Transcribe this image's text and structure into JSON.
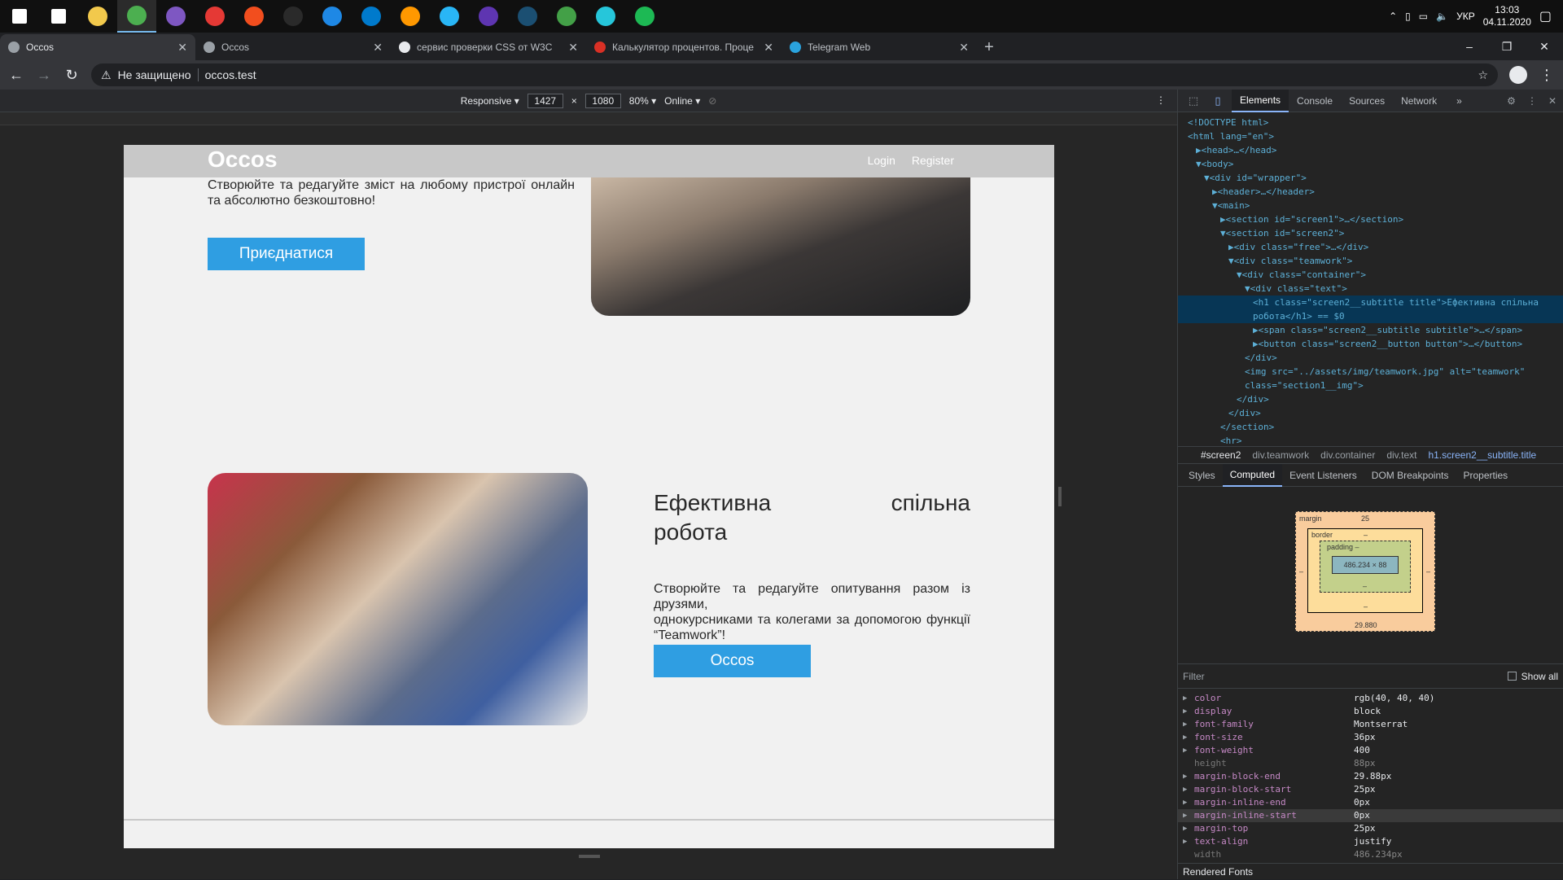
{
  "taskbar": {
    "icons": [
      {
        "name": "windows-start-icon",
        "color": "#ffffff"
      },
      {
        "name": "search-icon",
        "color": "#ffffff"
      },
      {
        "name": "file-explorer-icon",
        "color": "#f2c94c"
      },
      {
        "name": "chrome-icon",
        "color": "#4caf50"
      },
      {
        "name": "app-purple-icon",
        "color": "#7e57c2"
      },
      {
        "name": "app-rainbow-icon",
        "color": "#e53935"
      },
      {
        "name": "figma-icon",
        "color": "#f24e1e"
      },
      {
        "name": "epic-games-icon",
        "color": "#2a2a2a"
      },
      {
        "name": "app-blue-circle-icon",
        "color": "#1e88e5"
      },
      {
        "name": "vscode-icon",
        "color": "#007acc"
      },
      {
        "name": "sublime-text-icon",
        "color": "#ff9800"
      },
      {
        "name": "app-hexagon-icon",
        "color": "#29b6f6"
      },
      {
        "name": "app-dark-purple-icon",
        "color": "#5e35b1"
      },
      {
        "name": "steam-icon",
        "color": "#1b4f72"
      },
      {
        "name": "shield-icon",
        "color": "#43a047"
      },
      {
        "name": "app-teal-icon",
        "color": "#26c6da"
      },
      {
        "name": "spotify-icon",
        "color": "#1db954"
      }
    ],
    "language": "УКР",
    "time": "13:03",
    "date": "04.11.2020"
  },
  "tabs": [
    {
      "title": "Occos",
      "active": true,
      "color": "#9aa0a6"
    },
    {
      "title": "Occos",
      "active": false,
      "color": "#9aa0a6"
    },
    {
      "title": "сервис проверки CSS от W3C",
      "active": false,
      "color": "#e8eaed"
    },
    {
      "title": "Калькулятор процентов. Проце",
      "active": false,
      "color": "#d93025"
    },
    {
      "title": "Telegram Web",
      "active": false,
      "color": "#2aa3de"
    }
  ],
  "address": {
    "security": "Не защищено",
    "url": "occos.test"
  },
  "device_toolbar": {
    "mode": "Responsive",
    "width": "1427",
    "height": "1080",
    "zoom": "80%",
    "throttle": "Online"
  },
  "site": {
    "logo": "Occos",
    "nav_login": "Login",
    "nav_register": "Register",
    "screen1_text": "Створюйте та редагуйте зміст на любому пристрої онлайн та абсолютно безкоштовно!",
    "screen1_button": "Приєднатися",
    "screen2_title_line1": "Ефективна спільна",
    "screen2_title_line2": "робота",
    "screen2_text_line1": "Створюйте та редагуйте опитування разом із друзями,",
    "screen2_text_line2": "однокурсниками та колегами за допомогою функції “Teamwork”!",
    "screen2_button": "Occos"
  },
  "devtools": {
    "tabs": [
      "Elements",
      "Console",
      "Sources",
      "Network"
    ],
    "active_tab": "Elements",
    "more": "»",
    "dom_lines": [
      {
        "indent": 0,
        "text": "<!DOCTYPE html>",
        "sel": false
      },
      {
        "indent": 0,
        "text": "<html lang=\"en\">",
        "sel": false
      },
      {
        "indent": 1,
        "text": "▶<head>…</head>",
        "sel": false
      },
      {
        "indent": 1,
        "text": "▼<body>",
        "sel": false
      },
      {
        "indent": 2,
        "text": "▼<div id=\"wrapper\">",
        "sel": false
      },
      {
        "indent": 3,
        "text": "▶<header>…</header>",
        "sel": false
      },
      {
        "indent": 3,
        "text": "▼<main>",
        "sel": false
      },
      {
        "indent": 4,
        "text": "▶<section id=\"screen1\">…</section>",
        "sel": false
      },
      {
        "indent": 4,
        "text": "▼<section id=\"screen2\">",
        "sel": false
      },
      {
        "indent": 5,
        "text": "▶<div class=\"free\">…</div>",
        "sel": false
      },
      {
        "indent": 5,
        "text": "▼<div class=\"teamwork\">",
        "sel": false
      },
      {
        "indent": 6,
        "text": "▼<div class=\"container\">",
        "sel": false
      },
      {
        "indent": 7,
        "text": "▼<div class=\"text\">",
        "sel": false
      },
      {
        "indent": 8,
        "text": "<h1 class=\"screen2__subtitle title\">Ефективна спільна",
        "sel": true
      },
      {
        "indent": 8,
        "text": "робота</h1> == $0",
        "sel": true
      },
      {
        "indent": 8,
        "text": "▶<span class=\"screen2__subtitle subtitle\">…</span>",
        "sel": false
      },
      {
        "indent": 8,
        "text": "▶<button class=\"screen2__button button\">…</button>",
        "sel": false
      },
      {
        "indent": 7,
        "text": "</div>",
        "sel": false
      },
      {
        "indent": 7,
        "text": "<img src=\"../assets/img/teamwork.jpg\" alt=\"teamwork\"",
        "sel": false
      },
      {
        "indent": 7,
        "text": "class=\"section1__img\">",
        "sel": false
      },
      {
        "indent": 6,
        "text": "</div>",
        "sel": false
      },
      {
        "indent": 5,
        "text": "</div>",
        "sel": false
      },
      {
        "indent": 4,
        "text": "</section>",
        "sel": false
      },
      {
        "indent": 4,
        "text": "<hr>",
        "sel": false
      }
    ],
    "breadcrumbs": [
      "#screen2",
      "div.teamwork",
      "div.container",
      "div.text",
      "h1.screen2__subtitle.title"
    ],
    "sub_tabs": [
      "Styles",
      "Computed",
      "Event Listeners",
      "DOM Breakpoints",
      "Properties"
    ],
    "active_sub_tab": "Computed",
    "box_model": {
      "margin_label": "margin",
      "margin_top": "25",
      "margin_bottom": "29.880",
      "border_label": "border",
      "border_val": "–",
      "padding_label": "padding –",
      "padding_bottom": "–",
      "content": "486.234 × 88",
      "side": "–"
    },
    "filter_placeholder": "Filter",
    "show_all": "Show all",
    "computed": [
      {
        "name": "color",
        "value": "rgb(40, 40, 40)",
        "dim": false
      },
      {
        "name": "display",
        "value": "block",
        "dim": false
      },
      {
        "name": "font-family",
        "value": "Montserrat",
        "dim": false
      },
      {
        "name": "font-size",
        "value": "36px",
        "dim": false
      },
      {
        "name": "font-weight",
        "value": "400",
        "dim": false
      },
      {
        "name": "height",
        "value": "88px",
        "dim": true
      },
      {
        "name": "margin-block-end",
        "value": "29.88px",
        "dim": false
      },
      {
        "name": "margin-block-start",
        "value": "25px",
        "dim": false
      },
      {
        "name": "margin-inline-end",
        "value": "0px",
        "dim": false
      },
      {
        "name": "margin-inline-start",
        "value": "0px",
        "dim": false
      },
      {
        "name": "margin-top",
        "value": "25px",
        "dim": false
      },
      {
        "name": "text-align",
        "value": "justify",
        "dim": false
      },
      {
        "name": "width",
        "value": "486.234px",
        "dim": true
      }
    ],
    "rendered_fonts": "Rendered Fonts"
  }
}
